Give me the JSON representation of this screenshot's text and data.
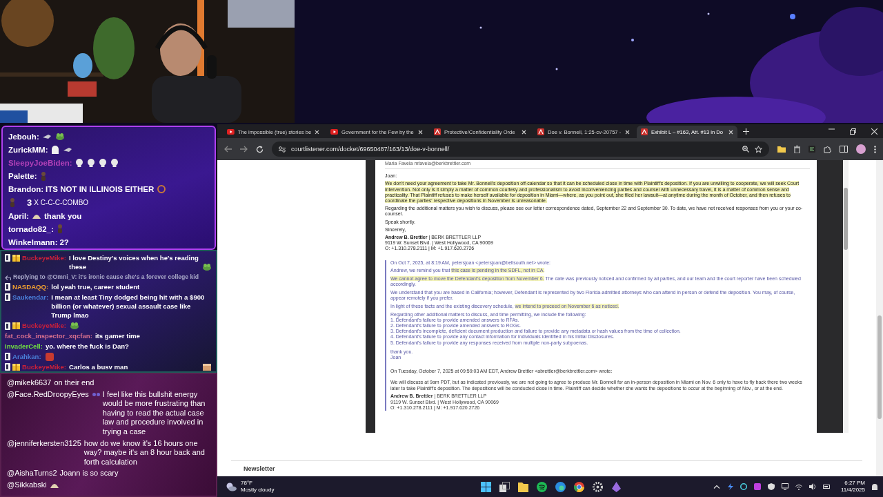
{
  "chat_overlay": {
    "messages": [
      {
        "kind": "message",
        "user": "Jebouh:",
        "color": "#ffffff",
        "parts": [
          {
            "kind": "hand"
          },
          {
            "kind": "frog"
          }
        ]
      },
      {
        "kind": "message",
        "user": "ZurickMM:",
        "color": "#ffffff",
        "parts": [
          {
            "kind": "ghost"
          },
          {
            "kind": "hand"
          }
        ]
      },
      {
        "kind": "message",
        "user": "SleepyJoeBiden:",
        "color": "#b040b8",
        "parts": [
          {
            "kind": "skull"
          },
          {
            "kind": "skull"
          },
          {
            "kind": "skull"
          },
          {
            "kind": "skull"
          }
        ]
      },
      {
        "kind": "message",
        "user": "Palette:",
        "color": "#ffffff",
        "parts": [
          {
            "kind": "figure"
          }
        ]
      },
      {
        "kind": "message",
        "user": "Brandon:",
        "color": "#ffffff",
        "parts": [
          {
            "kind": "text",
            "text": "ITS NOT IN ILLINOIS EITHER"
          },
          {
            "kind": "ring"
          }
        ]
      },
      {
        "kind": "combo",
        "parts": [
          {
            "kind": "figure"
          }
        ],
        "count": "3",
        "text": "X C-C-C-COMBO"
      },
      {
        "kind": "message",
        "user": "April:",
        "color": "#ffffff",
        "parts": [
          {
            "kind": "hat"
          },
          {
            "kind": "text",
            "text": "thank you"
          }
        ]
      },
      {
        "kind": "message",
        "user": "tornado82_:",
        "color": "#ffffff",
        "parts": [
          {
            "kind": "figure"
          }
        ]
      },
      {
        "kind": "message",
        "user": "Winkelmann:",
        "color": "#ffffff",
        "parts": [
          {
            "kind": "text",
            "text": "2?"
          }
        ]
      }
    ]
  },
  "chat_feed": {
    "messages": [
      {
        "kind": "message",
        "badges": [
          {
            "kind": "d"
          },
          {
            "kind": "gift"
          }
        ],
        "user": "BuckeyeMike:",
        "color": "#c8203a",
        "text": "I love Destiny's voices when he's reading these",
        "emotes": [
          {
            "kind": "frog"
          }
        ]
      },
      {
        "kind": "reply",
        "text": "Replying to @Omni_V: it's ironic cause she's a forever college kid"
      },
      {
        "kind": "message",
        "badges": [
          {
            "kind": "d"
          }
        ],
        "user": "NASDAQQ:",
        "color": "#f0a030",
        "text": "lol yeah true, career student"
      },
      {
        "kind": "message",
        "badges": [
          {
            "kind": "d"
          }
        ],
        "user": "Saukendar:",
        "color": "#4a7fd8",
        "text": "I mean at least Tiny dodged being hit with a $900 billion (or whatever) sexual assault case like Trump lmao"
      },
      {
        "kind": "message",
        "badges": [
          {
            "kind": "d"
          },
          {
            "kind": "gift"
          }
        ],
        "user": "BuckeyeMike:",
        "color": "#c8203a",
        "emotes": [
          {
            "kind": "frog"
          }
        ]
      },
      {
        "kind": "message",
        "user": "fat_cock_inspector_xqcfan:",
        "color": "#d8708e",
        "text": "its gamer time"
      },
      {
        "kind": "message",
        "user": "InvaderCell:",
        "color": "#70e040",
        "text": "yo. where the fuck is Dan?"
      },
      {
        "kind": "message",
        "badges": [
          {
            "kind": "d"
          }
        ],
        "user": "Arahkan:",
        "color": "#4a7fd8",
        "emotes": [
          {
            "kind": "face"
          }
        ]
      },
      {
        "kind": "message",
        "badges": [
          {
            "kind": "d"
          },
          {
            "kind": "gift"
          }
        ],
        "user": "BuckeyeMike:",
        "color": "#c8203a",
        "text": "Carlos a busv man",
        "emotes": [
          {
            "kind": "box"
          }
        ]
      }
    ]
  },
  "mentions": {
    "messages": [
      {
        "user": "@mikek6637",
        "text": "on their end"
      },
      {
        "user": "@Face.RedDroopyEyes",
        "emotes": [
          {
            "kind": "glasses"
          }
        ],
        "text": "I feel like this bullshit energy would be more frustrating than having to read the actual case law and procedure involved in trying a case"
      },
      {
        "user": "@jenniferkersten3125",
        "text": "how do we know it's 16 hours one way? maybe it's an 8 hour back and forth calculation"
      },
      {
        "user": "@AishaTurns2",
        "text": "Joann is so scary"
      },
      {
        "user": "@Sikkabski",
        "emotes": [
          {
            "kind": "hat"
          }
        ]
      }
    ]
  },
  "browser": {
    "tabs": [
      {
        "kind": "video",
        "title": "The impossible (true) stories be",
        "selected": false
      },
      {
        "kind": "video",
        "title": "Government for the Few by the",
        "selected": false
      },
      {
        "kind": "document",
        "title": "Protective/Confidentiality Orde",
        "selected": false
      },
      {
        "kind": "document",
        "title": "Doe v. Bonnell, 1:25-cv-20757 -",
        "selected": false
      },
      {
        "kind": "document",
        "title": "Exhibit L – #163, Att. #13 in Do",
        "selected": true
      }
    ],
    "url": "courtlistener.com/docket/69650487/163/13/doe-v-bonnell/",
    "document": {
      "top_line": "Maria Favela mfavela@berkbrettler.com",
      "reply": [
        [
          {
            "text": "Joan:",
            "highlight": false
          }
        ],
        [
          {
            "text": "We don't need your agreement to take Mr. Bonnell's deposition off-calendar so that it can be scheduled close in time with Plaintiff's deposition. If you are unwilling to cooperate, we will seek Court intervention. Not only is it simply a matter of common courtesy and professionalism to avoid inconveniencing parties and counsel with unnecessary travel, it is a matter of common sense and practicality. That Plaintiff refuses to make herself available for deposition in Miami—where, as you point out, she filed her lawsuit—at anytime during the month of October, and then refuses to coordinate the parties' respective depositions in November is unreasonable.",
            "highlight": true
          }
        ],
        [
          {
            "text": "Regarding the additional matters you wish to discuss, please see our letter correspondence dated, September 22 and September 30. To date, we have not received responses from you or your co-counsel.",
            "highlight": false
          }
        ],
        [
          {
            "text": "Speak shortly.",
            "highlight": false
          }
        ],
        [
          {
            "text": "Sincerely,",
            "highlight": false
          }
        ]
      ],
      "signature": [
        "**Andrew B. Brettler** | BERK BRETTLER LLP",
        "9119 W. Sunset Blvd. | West Hollywood, CA 90069",
        "O: +1.310.278.2111 | M: +1.917.620.2726"
      ],
      "quote_header": "On Oct 7, 2025, at 8:19 AM, petersjoan <petersjoan@bellsouth.net> wrote:",
      "quote": [
        [
          {
            "text": "Andrew, we remind you that ",
            "highlight": false
          },
          {
            "text": "this case is pending in the SDFL, not in CA.",
            "highlight": true
          }
        ],
        [
          {
            "text": "We cannot agree to move the Defendant's deposition from November 6.",
            "highlight": true
          },
          {
            "text": " The date was previously noticed and confirmed by all parties, and our team and the court reporter have been scheduled accordingly.",
            "highlight": false
          }
        ],
        [
          {
            "text": "We understand that you are based in California; however, Defendant is represented by two Florida-admitted attorneys who can attend in person or defend the deposition. You may, of course, appear remotely if you prefer.",
            "highlight": false
          }
        ],
        [
          {
            "text": "In light of these facts and the existing discovery schedule, ",
            "highlight": false
          },
          {
            "text": "we intend to proceed on November 6 as noticed.",
            "highlight": true
          }
        ]
      ],
      "list_intro": "Regarding other additional matters to discuss, and time permitting, we include the following:",
      "list": [
        "1. Defendant's failure to provide amended answers to RFAs.",
        "2. Defendant's failure to provide amended answers to ROGs.",
        "3. Defendant's incomplete, deficient document production and failure to provide any metadata or hash values from the time of collection.",
        "4. Defendant's failure to provide any contact information for individuals identified in his Initial Disclosures.",
        "5. Defendant's failure to provide any responses received from multiple non-party subpoenas."
      ],
      "closing": [
        "thank you.",
        "Joan"
      ],
      "forward_header": "On Tuesday, October 7, 2025 at 09:59:03 AM EDT, Andrew Brettler <abrettler@berkbrettler.com> wrote:",
      "forward": "We will discuss at 9am PDT, but as indicated previously, we are not going to agree to produce Mr. Bonnell for an in-person deposition in Miami on Nov. 6 only to have to fly back there two weeks later to take Plaintiff's deposition. The depositions will be conducted close in time. Plaintiff can decide whether she wants the depositions to occur at the beginning of Nov., or at the end.",
      "forward_signature": [
        "**Andrew B. Brettler** | BERK BRETTLER LLP",
        "9119 W. Sunset Blvd. | West Hollywood, CA 90069",
        "O: +1.310.278.2111 | M: +1.917.620.2726"
      ]
    },
    "footer_heading": "Newsletter"
  },
  "taskbar": {
    "temperature": "78°F",
    "weather": "Mostly cloudy",
    "time": "6:27 PM",
    "date": "11/4/2025"
  }
}
